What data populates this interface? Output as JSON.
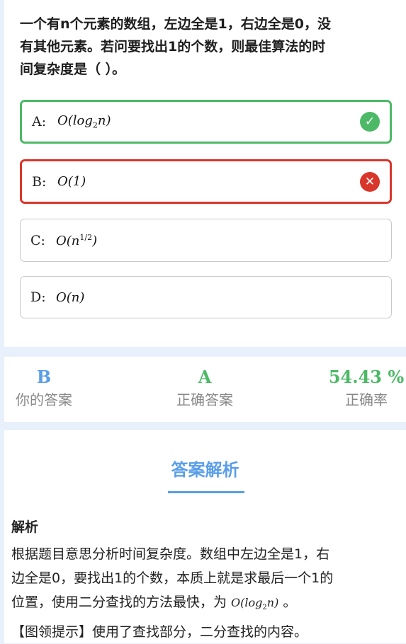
{
  "question": {
    "title_line1": "一个有n个元素的数组，左边全是1，右边全是0，没",
    "title_line2": "有其他元素。若问要找出1的个数，则最佳算法的时",
    "title_line3": "间复杂度是（ ）。"
  },
  "options": [
    {
      "letter": "A:",
      "math_prefix": "O(log",
      "math_sub": "2",
      "math_suffix": "n)",
      "state": "correct",
      "icon": "check-icon"
    },
    {
      "letter": "B:",
      "math_text": "O(1)",
      "state": "wrong",
      "icon": "x-icon"
    },
    {
      "letter": "C:",
      "math_prefix": "O(n",
      "math_sup": "1/2",
      "math_suffix": ")",
      "state": "neutral"
    },
    {
      "letter": "D:",
      "math_text": "O(n)",
      "state": "neutral"
    }
  ],
  "stats": {
    "your_answer": {
      "value": "B",
      "label": "你的答案",
      "color": "#5a9ee8"
    },
    "correct_answer": {
      "value": "A",
      "label": "正确答案",
      "color": "#4cb966"
    },
    "accuracy": {
      "value": "54.43 %",
      "label": "正确率",
      "color": "#4cb966"
    }
  },
  "analysis": {
    "heading": "答案解析",
    "sub_heading": "解析",
    "line1": "根据题目意思分析时间复杂度。数组中左边全是1，右",
    "line2": "边全是0，要找出1的个数，本质上就是求最后一个1的",
    "line3_prefix": "位置，使用二分查找的方法最快，为 ",
    "line3_math_prefix": "O(log",
    "line3_math_sub": "2",
    "line3_math_suffix": "n)",
    "line3_suffix": " 。",
    "line4": "【图领提示】使用了查找部分，二分查找的内容。"
  },
  "colors": {
    "accent": "#5a9ee8",
    "correct": "#4cb966",
    "wrong": "#d9362b",
    "background": "#e8f0fb"
  }
}
